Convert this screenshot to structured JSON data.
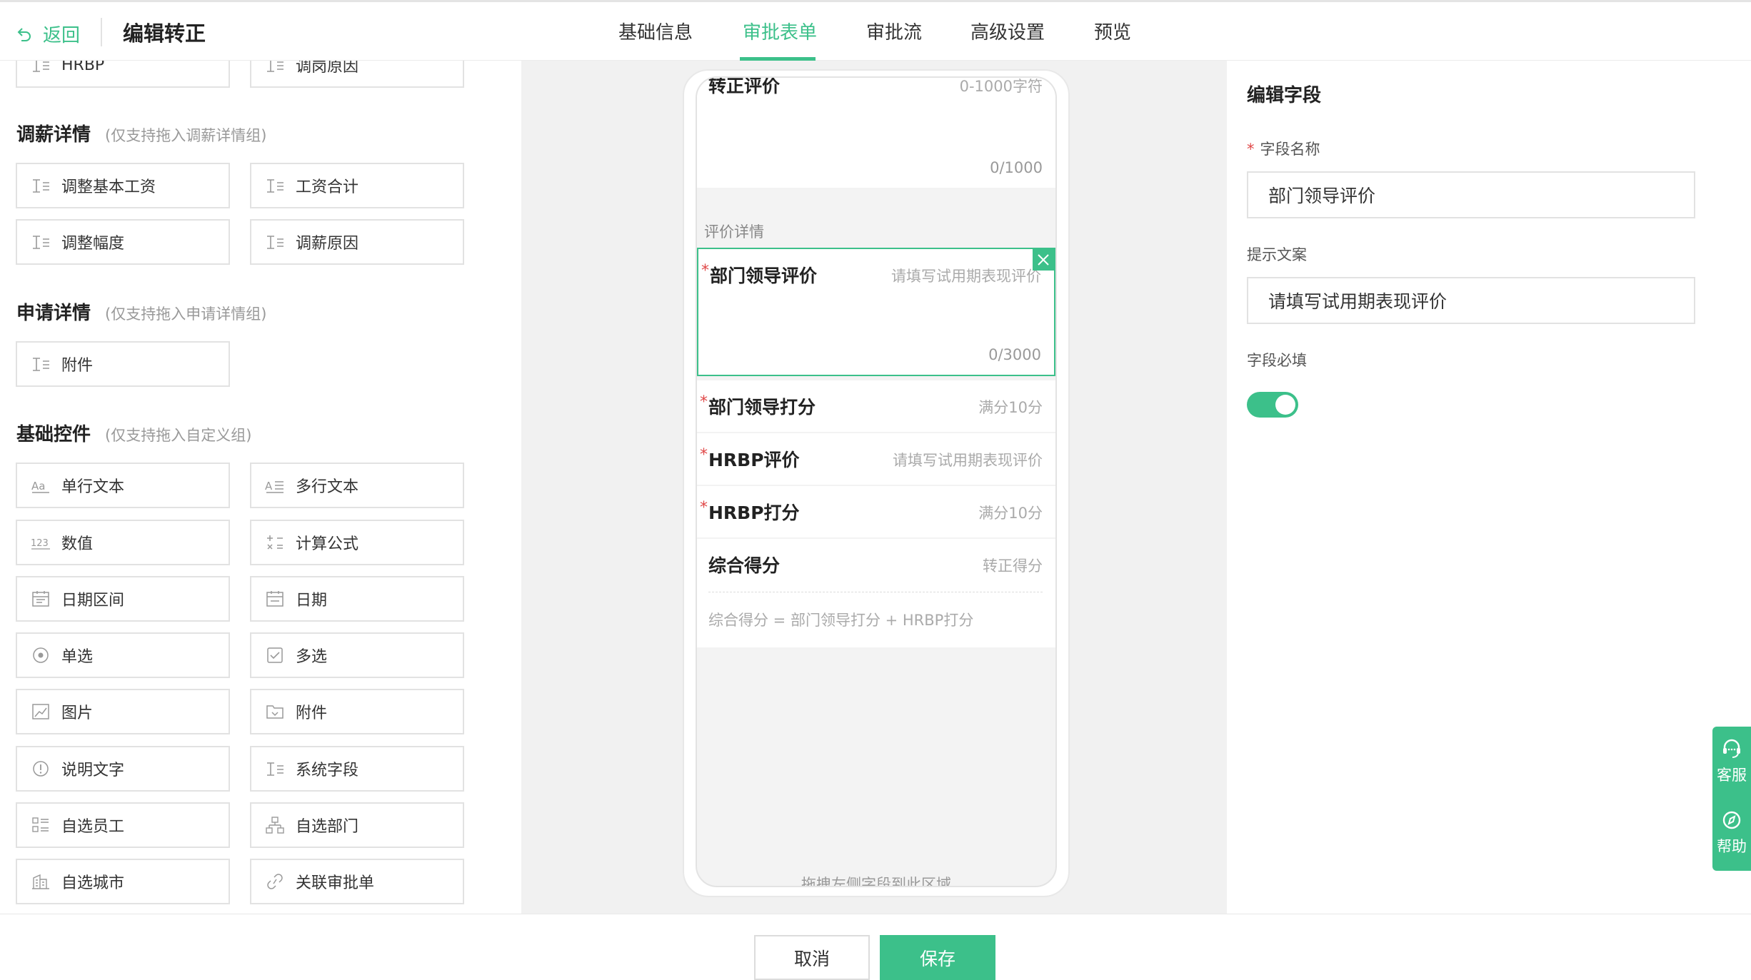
{
  "header": {
    "back_label": "返回",
    "title": "编辑转正",
    "tabs": [
      "基础信息",
      "审批表单",
      "审批流",
      "高级设置",
      "预览"
    ],
    "active_tab": "审批表单"
  },
  "left": {
    "top_partial": [
      "HRBP",
      "调岗原因"
    ],
    "sections": [
      {
        "title": "调薪详情",
        "hint": "(仅支持拖入调薪详情组)",
        "items": [
          "调整基本工资",
          "工资合计",
          "调整幅度",
          "调薪原因"
        ]
      },
      {
        "title": "申请详情",
        "hint": "(仅支持拖入申请详情组)",
        "items": [
          "附件"
        ]
      },
      {
        "title": "基础控件",
        "hint": "(仅支持拖入自定义组)",
        "items": [
          "单行文本",
          "多行文本",
          "数值",
          "计算公式",
          "日期区间",
          "日期",
          "单选",
          "多选",
          "图片",
          "附件",
          "说明文字",
          "系统字段",
          "自选员工",
          "自选部门",
          "自选城市",
          "关联审批单"
        ]
      }
    ]
  },
  "phone": {
    "f0": {
      "label": "转正评价",
      "placeholder": "0-1000字符",
      "count": "0/1000"
    },
    "group_label": "评价详情",
    "f1": {
      "label": "部门领导评价",
      "placeholder": "请填写试用期表现评价",
      "count": "0/3000"
    },
    "f2": {
      "label": "部门领导打分",
      "placeholder": "满分10分"
    },
    "f3": {
      "label": "HRBP评价",
      "placeholder": "请填写试用期表现评价"
    },
    "f4": {
      "label": "HRBP打分",
      "placeholder": "满分10分"
    },
    "f5": {
      "label": "综合得分",
      "placeholder": "转正得分",
      "formula": "综合得分 = 部门领导打分 + HRBP打分"
    },
    "drop_hint": "拖拽左侧字段到此区域"
  },
  "right": {
    "title": "编辑字段",
    "name_label": "字段名称",
    "name_value": "部门领导评价",
    "tip_label": "提示文案",
    "tip_value": "请填写试用期表现评价",
    "required_label": "字段必填",
    "required_on": true
  },
  "float": {
    "service": "客服",
    "help": "帮助"
  },
  "footer": {
    "cancel": "取消",
    "save": "保存"
  },
  "colors": {
    "accent": "#3cc08a",
    "required": "#e04848"
  }
}
